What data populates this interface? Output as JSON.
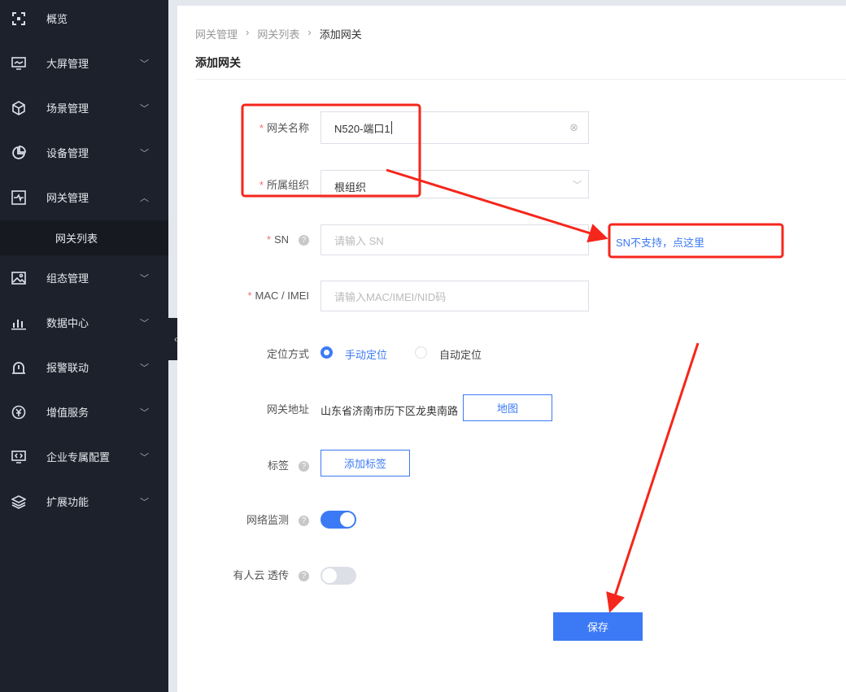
{
  "sidebar": {
    "items": [
      {
        "label": "概览",
        "icon": "overview-icon"
      },
      {
        "label": "大屏管理",
        "icon": "monitor-icon"
      },
      {
        "label": "场景管理",
        "icon": "cube-icon"
      },
      {
        "label": "设备管理",
        "icon": "pie-icon"
      },
      {
        "label": "网关管理",
        "icon": "pulse-icon"
      },
      {
        "label": "组态管理",
        "icon": "image-icon"
      },
      {
        "label": "数据中心",
        "icon": "bar-chart-icon"
      },
      {
        "label": "报警联动",
        "icon": "alarm-icon"
      },
      {
        "label": "增值服务",
        "icon": "yen-icon"
      },
      {
        "label": "企业专属配置",
        "icon": "code-screen-icon"
      },
      {
        "label": "扩展功能",
        "icon": "layers-icon"
      }
    ],
    "sub_item": "网关列表"
  },
  "breadcrumb": [
    "网关管理",
    "网关列表",
    "添加网关"
  ],
  "title": "添加网关",
  "form": {
    "name_label": "网关名称",
    "name_value": "N520-端口1",
    "org_label": "所属组织",
    "org_value": "根组织",
    "sn_label": "SN",
    "sn_placeholder": "请输入 SN",
    "mac_label": "MAC / IMEI",
    "mac_placeholder": "请输入MAC/IMEI/NID码",
    "locate_label": "定位方式",
    "locate_manual": "手动定位",
    "locate_auto": "自动定位",
    "locate_selected": "manual",
    "address_label": "网关地址",
    "address_value": "山东省济南市历下区龙奥南路",
    "map_button": "地图",
    "tag_label": "标签",
    "tag_button": "添加标签",
    "monitor_label": "网络监测",
    "monitor_on": true,
    "passthrough_label": "有人云 透传",
    "passthrough_on": false,
    "save": "保存"
  },
  "annotation": {
    "note": "SN不支持，点这里",
    "color": "#f5261b"
  },
  "colors": {
    "accent": "#3c7af5",
    "sidebar": "#1d212b"
  }
}
